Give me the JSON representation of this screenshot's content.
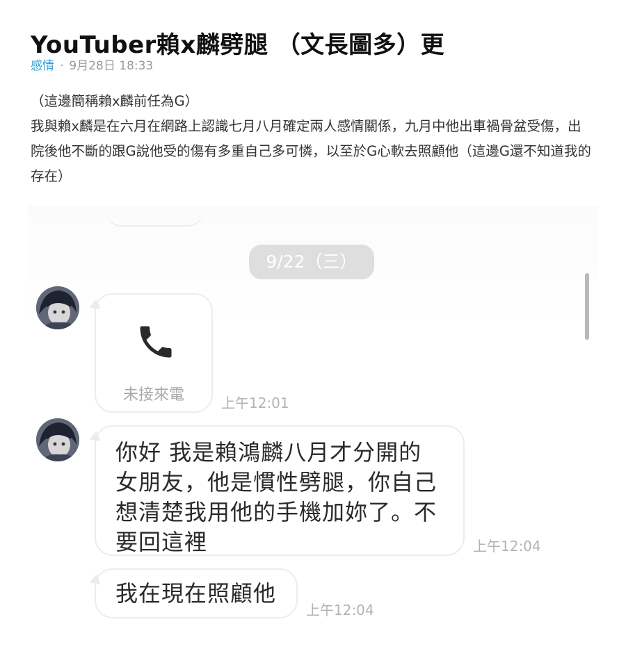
{
  "post": {
    "title": "YouTuber賴x麟劈腿 （文長圖多）更",
    "category": "感情",
    "separator": "·",
    "date": "9月28日 18:33",
    "paragraphs": [
      "（這邊簡稱賴x麟前任為G）",
      "我與賴x麟是在六月在網路上認識七月八月確定兩人感情關係，九月中他出車禍骨盆受傷，出院後他不斷的跟G說他受的傷有多重自己多可憐，以至於G心軟去照顧他（這邊G還不知道我的存在）"
    ]
  },
  "chat": {
    "date_pill": "9/22（三）",
    "missed_call_label": "未接來電",
    "missed_call_time": "上午12:01",
    "message_1": "你好 我是賴鴻麟八月才分開的女朋友，他是慣性劈腿，你自己想清楚我用他的手機加妳了。不要回這裡",
    "message_1_time": "上午12:04",
    "message_2": "我在現在照顧他",
    "message_2_time": "上午12:04",
    "icons": [
      "phone-icon",
      "avatar"
    ]
  },
  "colors": {
    "category_link": "#3a9fd6",
    "meta_gray": "#9a9a9a",
    "bubble_border": "#ececec",
    "date_pill_bg": "#dedede"
  }
}
